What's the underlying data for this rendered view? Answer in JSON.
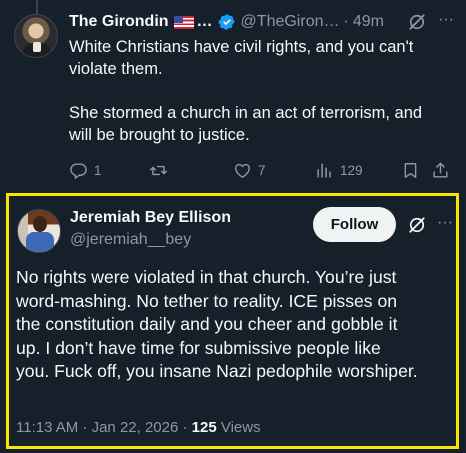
{
  "tweet1": {
    "display_name": "The Girondin",
    "name_ellipsis": "…",
    "handle": "@TheGiron…",
    "separator": "·",
    "time": "49m",
    "lines": [
      "White Christians have civil rights, and you can't",
      "violate them.",
      "She stormed a church in an act of terrorism, and",
      "will be brought to justice."
    ],
    "actions": {
      "replies": "1",
      "reposts": "",
      "likes": "7",
      "views": "129"
    },
    "icons": [
      "reply-icon",
      "repost-icon",
      "like-icon",
      "views-icon",
      "bookmark-icon",
      "share-icon",
      "verified-badge-icon",
      "us-flag-icon",
      "grok-icon",
      "more-icon"
    ]
  },
  "tweet2": {
    "display_name": "Jeremiah Bey Ellison",
    "handle": "@jeremiah__bey",
    "follow_label": "Follow",
    "lines": [
      "No rights were violated in that church. You’re just",
      "word-mashing. No tether to reality. ICE pisses on",
      "the constitution daily and you cheer and gobble it",
      "up. I don’t have time for submissive people like",
      "you. Fuck off, you insane Nazi pedophile worshiper."
    ],
    "timestamp": "11:13 AM · Jan 22, 2026 · ",
    "views_count": "125",
    "views_label": " Views"
  },
  "colors": {
    "background": "#15202b",
    "text": "#f7f9f9",
    "secondary_text": "#8b98a5",
    "highlight_border": "#f7e400",
    "verified_blue": "#1d9bf0",
    "follow_button": "#eff3f4"
  }
}
